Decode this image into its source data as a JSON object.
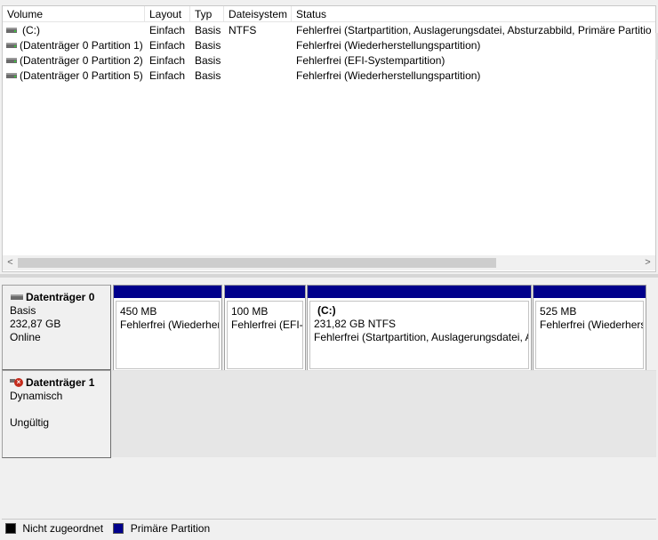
{
  "table": {
    "columns": [
      "Volume",
      "Layout",
      "Typ",
      "Dateisystem",
      "Status"
    ],
    "rows": [
      {
        "volume": "(C:)",
        "layout": "Einfach",
        "typ": "Basis",
        "fs": "NTFS",
        "status": "Fehlerfrei (Startpartition, Auslagerungsdatei, Absturzabbild, Primäre Partitio"
      },
      {
        "volume": "(Datenträger 0 Partition 1)",
        "layout": "Einfach",
        "typ": "Basis",
        "fs": "",
        "status": "Fehlerfrei (Wiederherstellungspartition)"
      },
      {
        "volume": "(Datenträger 0 Partition 2)",
        "layout": "Einfach",
        "typ": "Basis",
        "fs": "",
        "status": "Fehlerfrei (EFI-Systempartition)"
      },
      {
        "volume": "(Datenträger 0 Partition 5)",
        "layout": "Einfach",
        "typ": "Basis",
        "fs": "",
        "status": "Fehlerfrei (Wiederherstellungspartition)"
      }
    ],
    "scroll_left": "<",
    "scroll_right": ">"
  },
  "disks": [
    {
      "name": "Datenträger 0",
      "type": "Basis",
      "size": "232,87 GB",
      "state": "Online",
      "icon": "disk-icon",
      "partitions": [
        {
          "title": "",
          "size": "450 MB",
          "status": "Fehlerfrei (Wiederherstellungspartition)"
        },
        {
          "title": "",
          "size": "100 MB",
          "status": "Fehlerfrei (EFI-Systempartition)"
        },
        {
          "title": "(C:)",
          "size": "231,82 GB NTFS",
          "status": "Fehlerfrei (Startpartition, Auslagerungsdatei, Absturzabbild)"
        },
        {
          "title": "",
          "size": "525 MB",
          "status": "Fehlerfrei (Wiederherstellungspartition)"
        }
      ]
    },
    {
      "name": "Datenträger 1",
      "type": "Dynamisch",
      "size": "",
      "state": "Ungültig",
      "icon": "disk-error-icon"
    }
  ],
  "legend": [
    {
      "label": "Nicht zugeordnet",
      "color": "#000000"
    },
    {
      "label": "Primäre Partition",
      "color": "#00008b"
    }
  ]
}
